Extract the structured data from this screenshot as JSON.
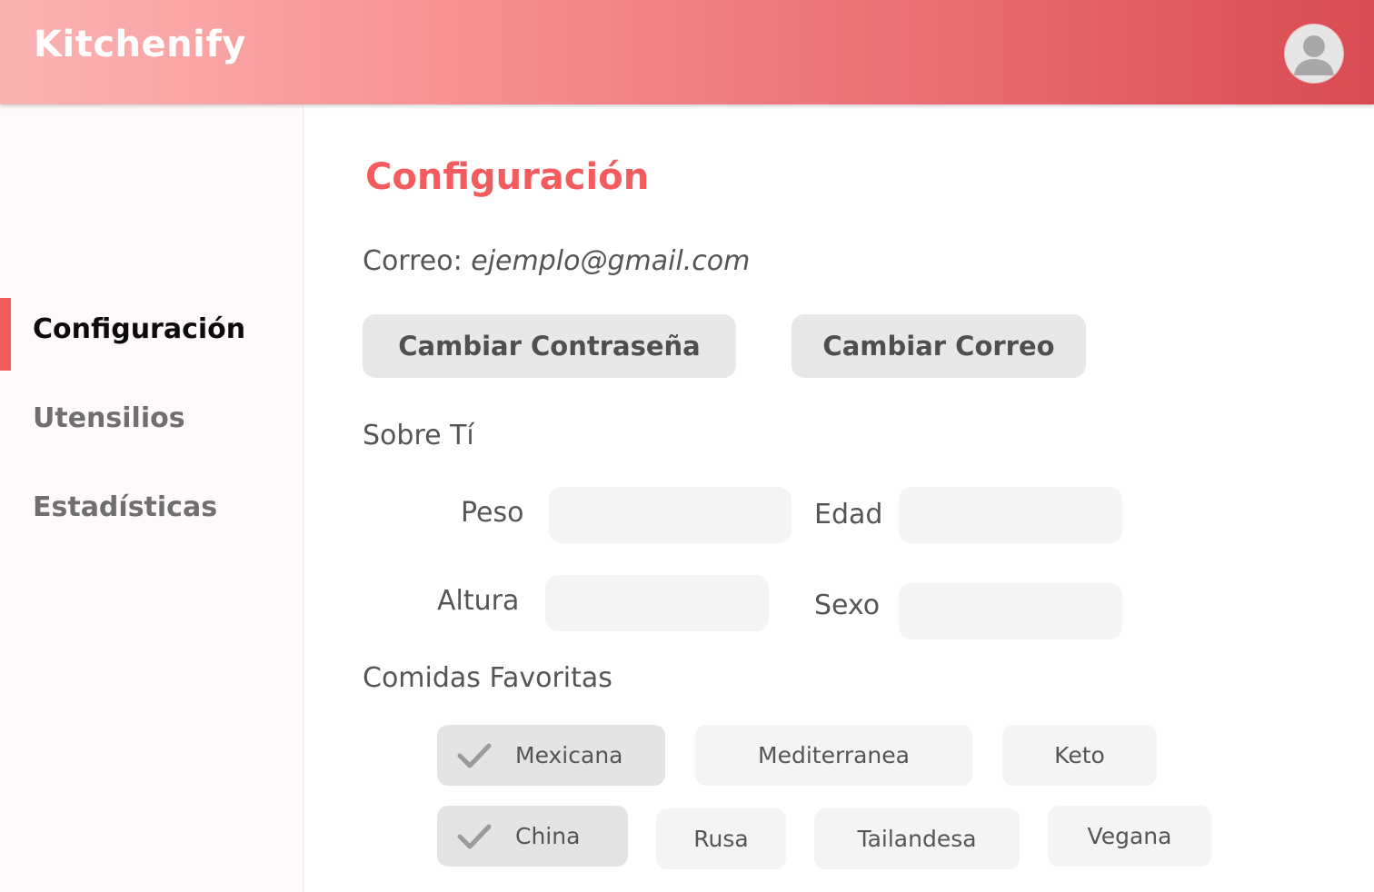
{
  "header": {
    "brand": "Kitchenify",
    "avatar_icon": "user-avatar-icon"
  },
  "sidebar": {
    "items": [
      {
        "label": "Configuración",
        "active": true
      },
      {
        "label": "Utensilios",
        "active": false
      },
      {
        "label": "Estadísticas",
        "active": false
      }
    ],
    "accent_color": "#f45b5f"
  },
  "main": {
    "title": "Configuración",
    "email_label": "Correo:",
    "email_value": "ejemplo@gmail.com",
    "change_password_label": "Cambiar Contraseña",
    "change_email_label": "Cambiar Correo",
    "about_label": "Sobre Tí",
    "fields": {
      "peso": {
        "label": "Peso",
        "value": ""
      },
      "edad": {
        "label": "Edad",
        "value": ""
      },
      "altura": {
        "label": "Altura",
        "value": ""
      },
      "sexo": {
        "label": "Sexo",
        "value": ""
      }
    },
    "favorites_label": "Comidas Favoritas",
    "foods": [
      {
        "label": "Mexicana",
        "selected": true
      },
      {
        "label": "Mediterranea",
        "selected": false
      },
      {
        "label": "Keto",
        "selected": false
      },
      {
        "label": "China",
        "selected": true
      },
      {
        "label": "Rusa",
        "selected": false
      },
      {
        "label": "Tailandesa",
        "selected": false
      },
      {
        "label": "Vegana",
        "selected": false
      }
    ]
  },
  "colors": {
    "header_gradient_start": "#fdb3b3",
    "header_gradient_end": "#d94b52",
    "title": "#f45b5f"
  }
}
